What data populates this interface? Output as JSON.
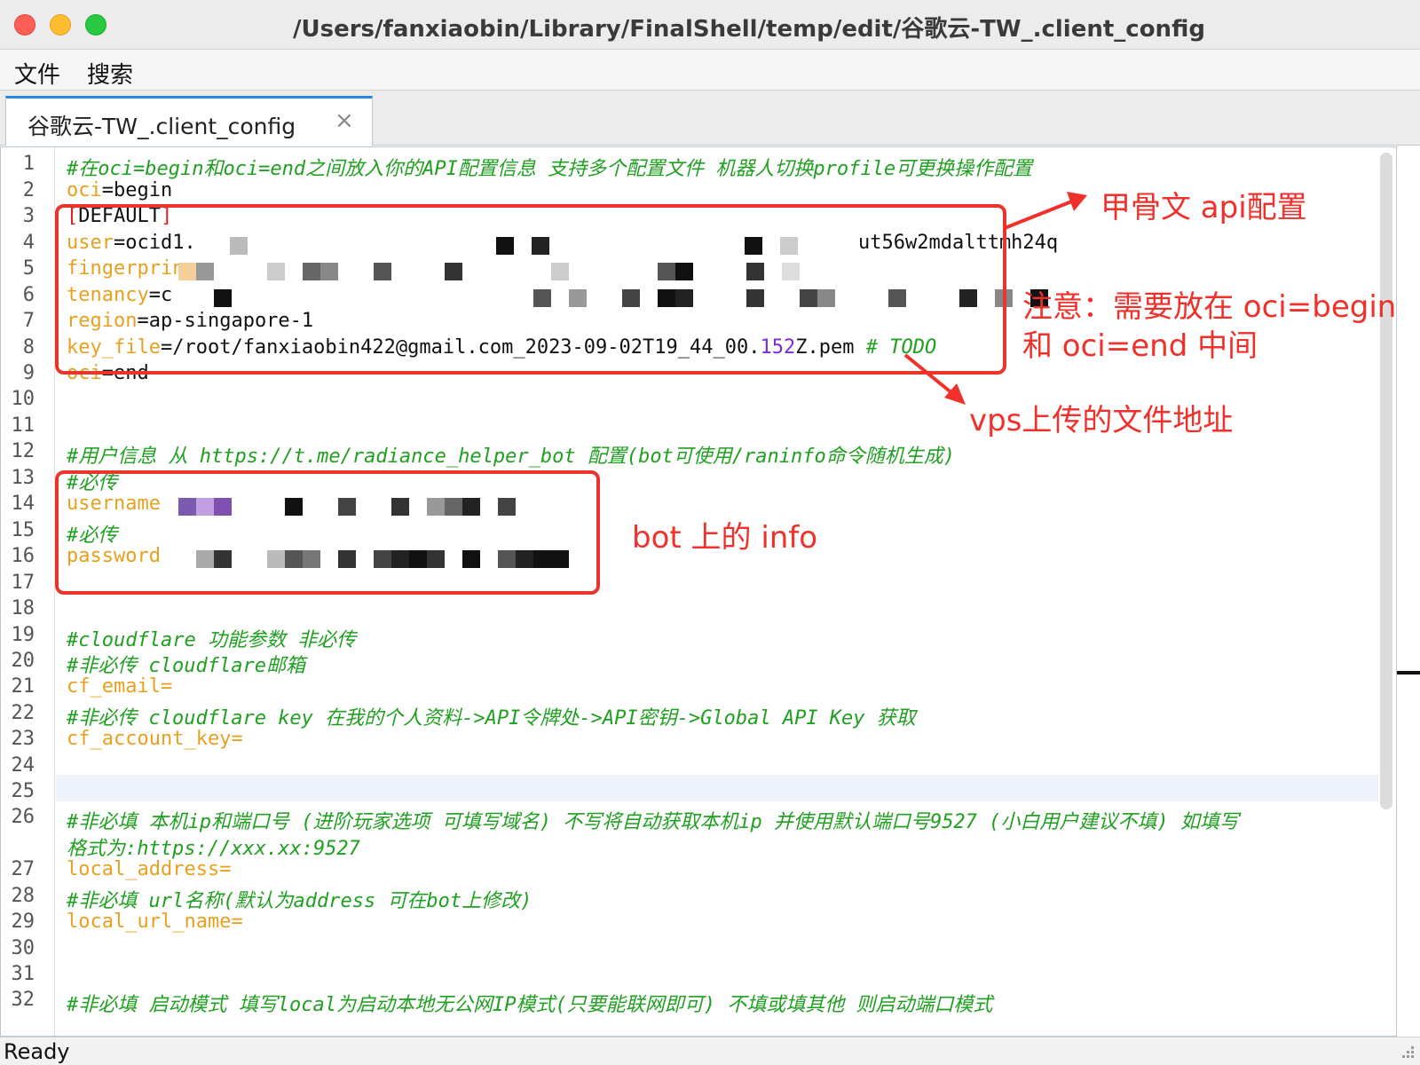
{
  "window": {
    "title": "/Users/fanxiaobin/Library/FinalShell/temp/edit/谷歌云-TW_.client_config"
  },
  "menu": {
    "file": "文件",
    "search": "搜索"
  },
  "tab": {
    "label": "谷歌云-TW_.client_config",
    "close_glyph": "×"
  },
  "editor": {
    "line_numbers": [
      "1",
      "2",
      "3",
      "4",
      "5",
      "6",
      "7",
      "8",
      "9",
      "10",
      "11",
      "12",
      "13",
      "14",
      "15",
      "16",
      "17",
      "18",
      "19",
      "20",
      "21",
      "22",
      "23",
      "24",
      "25",
      "26",
      "27",
      "28",
      "29",
      "30",
      "31",
      "32"
    ],
    "lines": {
      "l1": "#在oci=begin和oci=end之间放入你的API配置信息 支持多个配置文件 机器人切换profile可更换操作配置",
      "l2_key": "oci",
      "l2_value": "begin",
      "l3_open": "[",
      "l3_text": "DEFAULT",
      "l3_close": "]",
      "l4_key": "user",
      "l4_value_start": "ocid1.",
      "l4_value_end": "ut56w2mdalttmh24q",
      "l5_key": "fingerprin",
      "l6_key": "tenancy",
      "l6_value": "c",
      "l7_key": "region",
      "l7_value": "ap-singapore-1",
      "l8_key": "key_file",
      "l8_value_a": "/root/fanxiaobin422@gmail.com_2023-09-02T19_44_00.",
      "l8_value_num": "152",
      "l8_value_b": "Z.pem",
      "l8_comment": "# TODO",
      "l9_key": "oci",
      "l9_value": "end",
      "l12": "#用户信息 从 https://t.me/radiance_helper_bot 配置(bot可使用/raninfo命令随机生成)",
      "l13": "#必传",
      "l14_key": "username",
      "l15": "#必传",
      "l16_key": "password",
      "l19": "#cloudflare 功能参数 非必传",
      "l20": "#非必传 cloudflare邮箱",
      "l21_key": "cf_email",
      "l22": "#非必传 cloudflare key 在我的个人资料->API令牌处->API密钥->Global API Key 获取",
      "l23_key": "cf_account_key",
      "l26a": "#非必填 本机ip和端口号 (进阶玩家选项 可填写域名) 不写将自动获取本机ip 并使用默认端口号9527 (小白用户建议不填) 如填写",
      "l26b": "格式为:https://xxx.xx:9527",
      "l27_key": "local_address",
      "l28": "#非必填 url名称(默认为address 可在bot上修改)",
      "l29_key": "local_url_name",
      "l32": "#非必填 启动模式 填写local为启动本地无公网IP模式(只要能联网即可) 不填或填其他 则启动端口模式",
      "eq": "="
    }
  },
  "annotations": {
    "api_config": "甲骨文 api配置",
    "note_line1": "注意：需要放在 oci=begin",
    "note_line2": "和 oci=end 中间",
    "vps_file": "vps上传的文件地址",
    "bot_info": "bot 上的 info"
  },
  "status": {
    "text": "Ready"
  },
  "colors": {
    "comment": "#20a020",
    "key": "#e8a020",
    "annotation": "#f0302a",
    "tab_accent": "#2a86e0"
  }
}
